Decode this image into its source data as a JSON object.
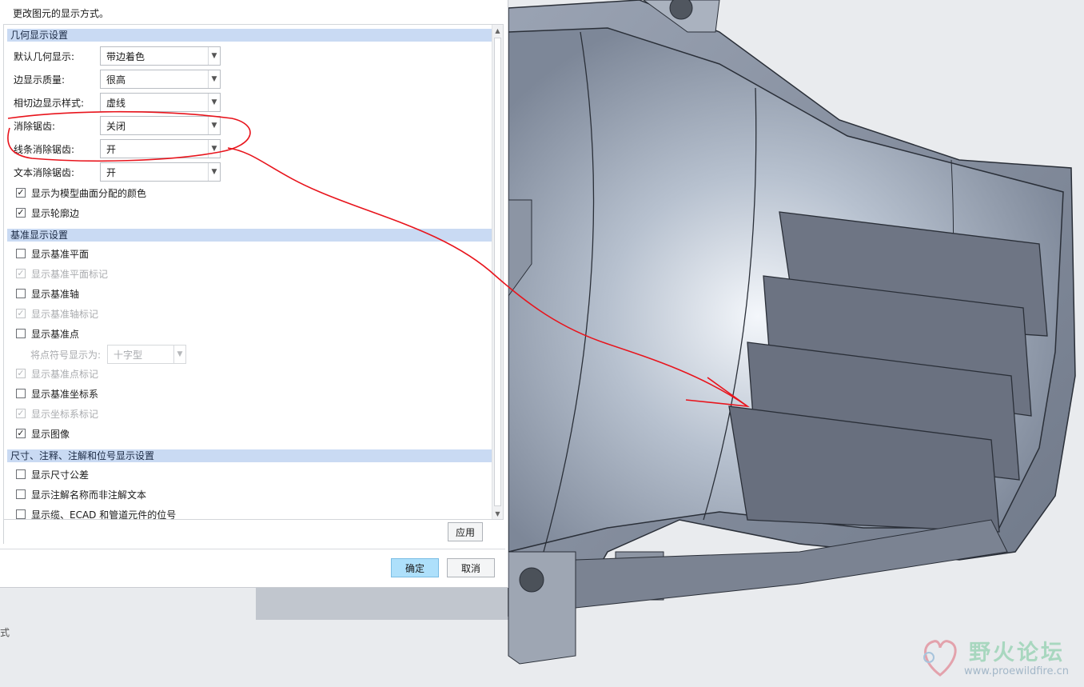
{
  "dialog": {
    "description": "更改图元的显示方式。",
    "sections": {
      "geometry": "几何显示设置",
      "datum": "基准显示设置",
      "dimension": "尺寸、注释、注解和位号显示设置"
    },
    "fields": [
      {
        "label": "默认几何显示:",
        "value": "带边着色"
      },
      {
        "label": "边显示质量:",
        "value": "很高"
      },
      {
        "label": "相切边显示样式:",
        "value": "虚线"
      },
      {
        "label": "消除锯齿:",
        "value": "关闭"
      },
      {
        "label": "线条消除锯齿:",
        "value": "开"
      },
      {
        "label": "文本消除锯齿:",
        "value": "开"
      }
    ],
    "geometry_checks": [
      {
        "label": "显示为模型曲面分配的颜色",
        "mark": "✓"
      },
      {
        "label": "显示轮廓边",
        "mark": "✓"
      }
    ],
    "datum_checks": [
      {
        "label": "显示基准平面",
        "mark": ""
      },
      {
        "label": "显示基准平面标记",
        "mark": "✓"
      },
      {
        "label": "显示基准轴",
        "mark": ""
      },
      {
        "label": "显示基准轴标记",
        "mark": "✓"
      },
      {
        "label": "显示基准点",
        "mark": ""
      },
      {
        "label": "显示基准点标记",
        "mark": "✓"
      },
      {
        "label": "显示基准坐标系",
        "mark": ""
      },
      {
        "label": "显示坐标系标记",
        "mark": "✓"
      },
      {
        "label": "显示图像",
        "mark": "✓"
      }
    ],
    "point_symbol": {
      "label": "将点符号显示为:",
      "value": "十字型"
    },
    "dimension_checks": [
      {
        "label": "显示尺寸公差",
        "mark": ""
      },
      {
        "label": "显示注解名称而非注解文本",
        "mark": ""
      },
      {
        "label": "显示缆、ECAD 和管道元件的位号",
        "mark": ""
      }
    ],
    "buttons": {
      "apply": "应用",
      "ok": "确定",
      "cancel": "取消"
    }
  },
  "background_text": "式",
  "watermark": {
    "title": "野火论坛",
    "url": "www.proewildfire.cn"
  },
  "colors": {
    "section_header": "#c9daf3",
    "primary_button": "#aee0fb",
    "annotation": "#e8141c"
  },
  "icons": {
    "dropdown": "chevron-down-icon",
    "scroll_up": "scroll-up-arrow-icon",
    "scroll_down": "scroll-down-arrow-icon",
    "checkbox": "check-icon"
  }
}
